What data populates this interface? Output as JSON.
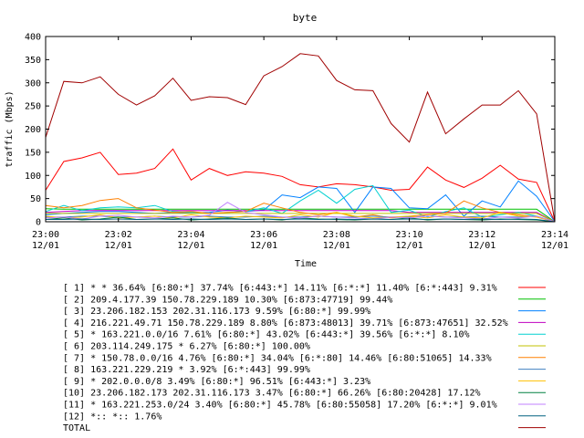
{
  "chart_data": {
    "type": "line",
    "title": "byte",
    "xlabel": "Time",
    "ylabel": "traffic (Mbps)",
    "ylim": [
      0,
      400
    ],
    "xlim": [
      0,
      14
    ],
    "yticks": [
      "0",
      "50",
      "100",
      "150",
      "200",
      "250",
      "300",
      "350",
      "400"
    ],
    "xticks": [
      {
        "time": "23:00",
        "date": "12/01"
      },
      {
        "time": "23:02",
        "date": "12/01"
      },
      {
        "time": "23:04",
        "date": "12/01"
      },
      {
        "time": "23:06",
        "date": "12/01"
      },
      {
        "time": "23:08",
        "date": "12/01"
      },
      {
        "time": "23:10",
        "date": "12/01"
      },
      {
        "time": "23:12",
        "date": "12/01"
      },
      {
        "time": "23:14",
        "date": "12/01"
      }
    ],
    "grid": false,
    "legend_placement": "bottom",
    "x_minutes": [
      0,
      0.5,
      1,
      1.5,
      2,
      2.5,
      3,
      3.5,
      4,
      4.5,
      5,
      5.5,
      6,
      6.5,
      7,
      7.5,
      8,
      8.5,
      9,
      9.5,
      10,
      10.5,
      11,
      11.5,
      12,
      12.5,
      13,
      13.5,
      14
    ],
    "series": [
      {
        "name": "[ 1] * * 36.64%  [6:80:*] 37.74% [6:443:*] 14.11% [6:*:*] 11.40% [6:*:443] 9.31%",
        "color": "#ff0000",
        "values": [
          68,
          130,
          138,
          150,
          102,
          105,
          115,
          157,
          90,
          115,
          100,
          108,
          105,
          98,
          80,
          75,
          82,
          80,
          75,
          68,
          70,
          118,
          90,
          74,
          94,
          122,
          92,
          85,
          0
        ]
      },
      {
        "name": "[ 2] 209.4.177.39 150.78.229.189 10.30%  [6:873:47719] 99.44%",
        "color": "#00c000",
        "values": [
          28,
          27,
          27,
          27,
          27,
          27,
          27,
          27,
          27,
          27,
          27,
          27,
          27,
          27,
          27,
          27,
          27,
          27,
          27,
          27,
          27,
          27,
          27,
          27,
          27,
          27,
          27,
          27,
          0
        ]
      },
      {
        "name": "[ 3] 23.206.182.153 202.31.116.173 9.59%  [6:80:*] 99.99%",
        "color": "#0080ff",
        "values": [
          15,
          18,
          20,
          22,
          22,
          20,
          18,
          20,
          19,
          20,
          25,
          22,
          25,
          58,
          52,
          75,
          72,
          20,
          75,
          72,
          30,
          28,
          58,
          12,
          45,
          32,
          88,
          55,
          0
        ]
      },
      {
        "name": "[ 4] 216.221.49.71 150.78.229.189 8.80%  [6:873:48013] 39.71% [6:873:47651] 32.52%",
        "color": "#c000c0",
        "values": [
          20,
          22,
          24,
          24,
          24,
          24,
          24,
          24,
          24,
          24,
          24,
          24,
          24,
          24,
          24,
          24,
          24,
          24,
          24,
          24,
          20,
          20,
          20,
          20,
          20,
          20,
          20,
          20,
          0
        ]
      },
      {
        "name": "[ 5] * 163.221.0.0/16 7.61%  [6:80:*] 43.02% [6:443:*] 39.56% [6:*:*] 8.10%",
        "color": "#00d0d0",
        "values": [
          22,
          35,
          24,
          30,
          32,
          30,
          35,
          22,
          20,
          18,
          20,
          22,
          30,
          18,
          45,
          68,
          40,
          70,
          78,
          20,
          25,
          10,
          22,
          30,
          10,
          15,
          20,
          12,
          0
        ]
      },
      {
        "name": "[ 6] 203.114.249.175 * 6.27%  [6:80:*] 100.00%",
        "color": "#c0c000",
        "values": [
          18,
          18,
          18,
          18,
          18,
          18,
          18,
          18,
          18,
          18,
          18,
          18,
          18,
          18,
          18,
          18,
          18,
          18,
          18,
          18,
          18,
          18,
          18,
          18,
          18,
          18,
          18,
          18,
          0
        ]
      },
      {
        "name": "[ 7] * 150.78.0.0/16 4.76%  [6:80:*] 34.04% [6:*:80] 14.46% [6:80:51065] 14.33%",
        "color": "#ff8000",
        "values": [
          35,
          30,
          35,
          46,
          50,
          30,
          25,
          20,
          22,
          18,
          20,
          22,
          40,
          30,
          20,
          15,
          20,
          10,
          15,
          8,
          12,
          15,
          18,
          45,
          30,
          20,
          15,
          10,
          0
        ]
      },
      {
        "name": "[ 8] 163.221.229.219 * 3.92%  [6:*:443] 99.99%",
        "color": "#4080c0",
        "values": [
          10,
          10,
          12,
          12,
          10,
          10,
          12,
          10,
          10,
          12,
          10,
          10,
          12,
          10,
          10,
          12,
          10,
          10,
          12,
          10,
          10,
          12,
          10,
          10,
          12,
          10,
          10,
          12,
          0
        ]
      },
      {
        "name": "[ 9] * 202.0.0.0/8 3.49%  [6:80:*] 96.51% [6:443:*] 3.23%",
        "color": "#ffc000",
        "values": [
          12,
          8,
          10,
          15,
          8,
          10,
          12,
          8,
          15,
          10,
          8,
          12,
          10,
          8,
          15,
          10,
          20,
          12,
          8,
          10,
          12,
          8,
          15,
          10,
          8,
          20,
          12,
          10,
          0
        ]
      },
      {
        "name": "[10] 23.206.182.173 202.31.116.173 3.47%  [6:80:*] 66.26% [6:80:20428] 17.12%",
        "color": "#008040",
        "values": [
          5,
          8,
          4,
          6,
          10,
          5,
          6,
          8,
          4,
          6,
          8,
          5,
          6,
          4,
          8,
          6,
          5,
          4,
          6,
          5,
          8,
          4,
          6,
          5,
          4,
          6,
          5,
          4,
          0
        ]
      },
      {
        "name": "[11] * 163.221.253.0/24 3.40%  [6:80:*] 45.78% [6:80:55058] 17.20% [6:*:*] 9.01%",
        "color": "#c080ff",
        "values": [
          8,
          10,
          6,
          12,
          14,
          10,
          8,
          12,
          10,
          14,
          42,
          20,
          15,
          10,
          8,
          12,
          10,
          8,
          6,
          10,
          8,
          12,
          10,
          8,
          6,
          10,
          8,
          12,
          0
        ]
      },
      {
        "name": "[12] *:: *:: 1.76%",
        "color": "#006080",
        "values": [
          5,
          5,
          6,
          5,
          6,
          5,
          6,
          5,
          6,
          5,
          6,
          5,
          6,
          5,
          6,
          5,
          6,
          5,
          6,
          5,
          6,
          5,
          6,
          5,
          6,
          5,
          6,
          5,
          0
        ]
      },
      {
        "name": "TOTAL",
        "color": "#a00000",
        "values": [
          182,
          303,
          300,
          313,
          275,
          252,
          272,
          310,
          262,
          270,
          268,
          253,
          315,
          335,
          363,
          358,
          305,
          285,
          283,
          212,
          172,
          280,
          190,
          222,
          252,
          252,
          283,
          233,
          0
        ]
      }
    ]
  }
}
